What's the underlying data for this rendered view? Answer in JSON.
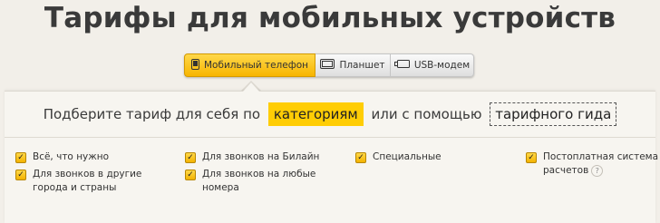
{
  "page_title": "Тарифы для мобильных устройств",
  "tabs": [
    {
      "label": "Мобильный телефон",
      "icon": "phone-icon",
      "active": true
    },
    {
      "label": "Планшет",
      "icon": "tablet-icon",
      "active": false
    },
    {
      "label": "USB-модем",
      "icon": "usb-modem-icon",
      "active": false
    }
  ],
  "headline": {
    "prefix": "Подберите тариф для себя по",
    "link_categories": "категориям",
    "middle": "или с помощью",
    "link_guide": "тарифного гида"
  },
  "filters": {
    "col1": [
      {
        "line1": "Всё, что нужно",
        "line2": "",
        "checked": true
      },
      {
        "line1": "Для звонков в другие",
        "line2": "города и страны",
        "checked": true
      }
    ],
    "col2": [
      {
        "line1": "Для звонков на Билайн",
        "line2": "",
        "checked": true
      },
      {
        "line1": "Для звонков на любые",
        "line2": "номера",
        "checked": true
      }
    ],
    "col3": [
      {
        "line1": "Специальные",
        "line2": "",
        "checked": true
      }
    ],
    "col4": [
      {
        "line1": "Постоплатная система",
        "line2": "расчетов",
        "checked": true,
        "help": "?"
      }
    ]
  },
  "colors": {
    "accent": "#ffcd05",
    "background": "#f2efe9"
  }
}
